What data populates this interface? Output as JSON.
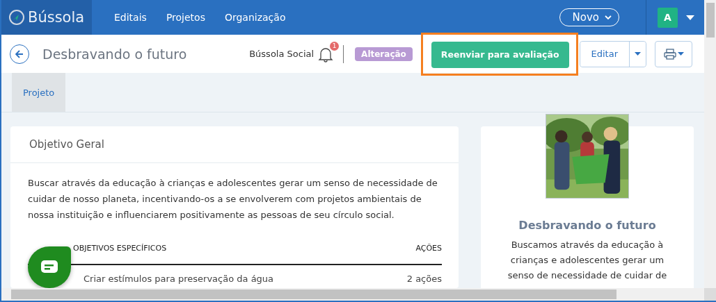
{
  "navbar": {
    "brand": "Bússola",
    "links": [
      {
        "label": "Editais"
      },
      {
        "label": "Projetos"
      },
      {
        "label": "Organização"
      }
    ],
    "new_button": "Novo",
    "avatar": "A"
  },
  "header": {
    "title": "Desbravando o futuro",
    "organization": "Bússola Social",
    "notification_count": "1",
    "status_tag": "Alteração",
    "primary_button": {
      "label": "Reenviar para avaliação",
      "highlighted": true
    },
    "edit_button": "Editar"
  },
  "tabs": [
    {
      "label": "Projeto",
      "selected": true
    }
  ],
  "objective": {
    "title": "Objetivo Geral",
    "text": "Buscar através da educação à crianças e adolescentes gerar um senso de necessidade de cuidar de nosso planeta, incentivando-os a se envolverem com projetos ambientais de nossa instituição e influenciarem positivamente as pessoas de seu círculo social.",
    "columns": [
      "OBJETIVOS ESPECÍFICOS",
      "AÇÕES"
    ],
    "rows": [
      {
        "objective": "Criar estímulos para preservação da água",
        "actions": "2 ações"
      }
    ]
  },
  "project_card": {
    "title": "Desbravando o futuro",
    "description": "Buscamos através da educação à crianças e adolescentes gerar um senso de necessidade de cuidar de"
  }
}
